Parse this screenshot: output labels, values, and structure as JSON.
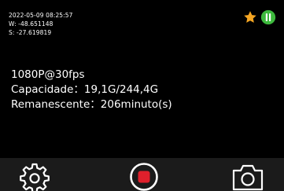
{
  "hud": {
    "datetime": "2022-05-09 08:25:57",
    "west": "W: -48.651148",
    "south": "S: -27.619819"
  },
  "status_icons": {
    "favorite": "star-icon",
    "gps": "gps-lock-icon",
    "star_color": "#f5a623",
    "gps_color": "#3db93d"
  },
  "recording_info": {
    "resolution": "1080P@30fps",
    "capacity": "Capacidade：19,1G/244,4G",
    "remaining": "Remanescente：206minuto(s)"
  },
  "toolbar": {
    "settings_icon": "gear-icon",
    "record_icon": "record-icon",
    "photo_icon": "camera-icon",
    "record_color": "#e0202c"
  }
}
